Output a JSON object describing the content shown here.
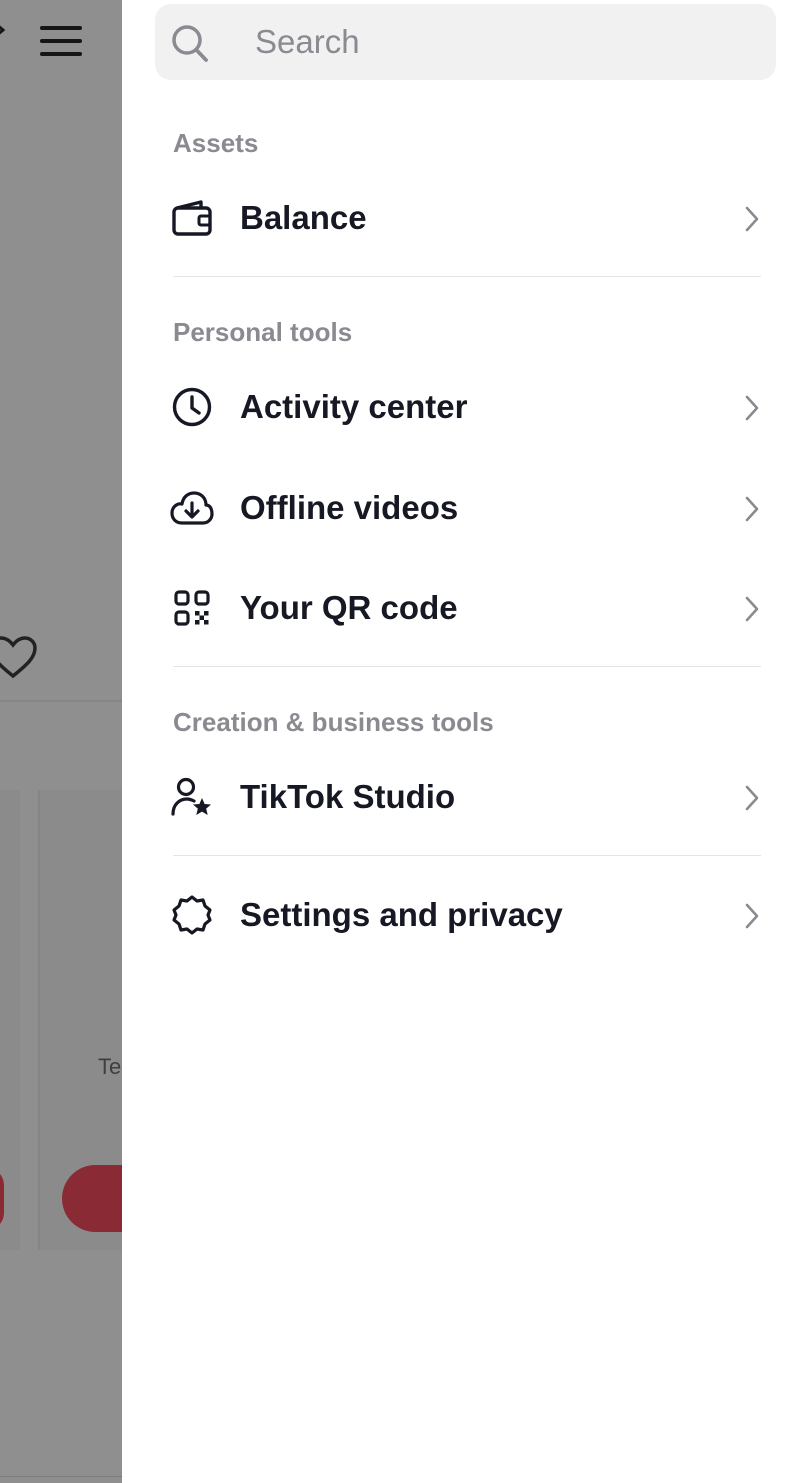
{
  "search": {
    "placeholder": "Search"
  },
  "sections": {
    "assets": {
      "title": "Assets"
    },
    "personal_tools": {
      "title": "Personal tools"
    },
    "creation_business": {
      "title": "Creation & business tools"
    }
  },
  "items": {
    "balance": {
      "label": "Balance",
      "icon": "wallet-icon"
    },
    "activity_center": {
      "label": "Activity center",
      "icon": "clock-icon"
    },
    "offline_videos": {
      "label": "Offline videos",
      "icon": "cloud-download-icon"
    },
    "qr_code": {
      "label": "Your QR code",
      "icon": "qr-code-icon"
    },
    "tiktok_studio": {
      "label": "TikTok Studio",
      "icon": "user-star-icon"
    },
    "settings_privacy": {
      "label": "Settings and privacy",
      "icon": "gear-icon"
    }
  },
  "backdrop": {
    "partial_text": "Te"
  },
  "colors": {
    "text": "#161823",
    "muted": "#8a8b91",
    "accent": "#8a2a35",
    "overlay": "#8f8f8f"
  }
}
